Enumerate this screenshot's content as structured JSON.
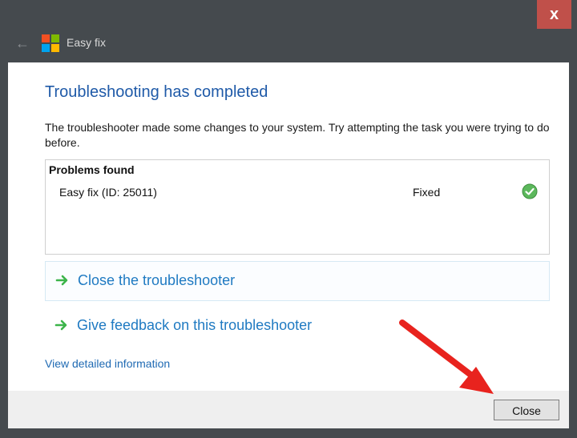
{
  "window": {
    "title": "Easy fix",
    "close_glyph": "x"
  },
  "main": {
    "heading": "Troubleshooting has completed",
    "message": "The troubleshooter made some changes to your system. Try attempting the task you were trying to do before."
  },
  "problems": {
    "header": "Problems found",
    "items": [
      {
        "name": "Easy fix (ID: 25011)",
        "status": "Fixed",
        "status_icon": "check-circle-icon",
        "status_color": "#5cb85c"
      }
    ]
  },
  "actions": [
    {
      "label": "Close the troubleshooter",
      "icon": "green-arrow-icon"
    },
    {
      "label": "Give feedback on this troubleshooter",
      "icon": "green-arrow-icon"
    }
  ],
  "links": {
    "view_details": "View detailed information"
  },
  "footer": {
    "close_label": "Close"
  },
  "colors": {
    "heading_blue": "#1f5aa8",
    "link_blue": "#1f7ac2",
    "arrow_green": "#3cb44a",
    "annotation_red": "#e8231e"
  }
}
